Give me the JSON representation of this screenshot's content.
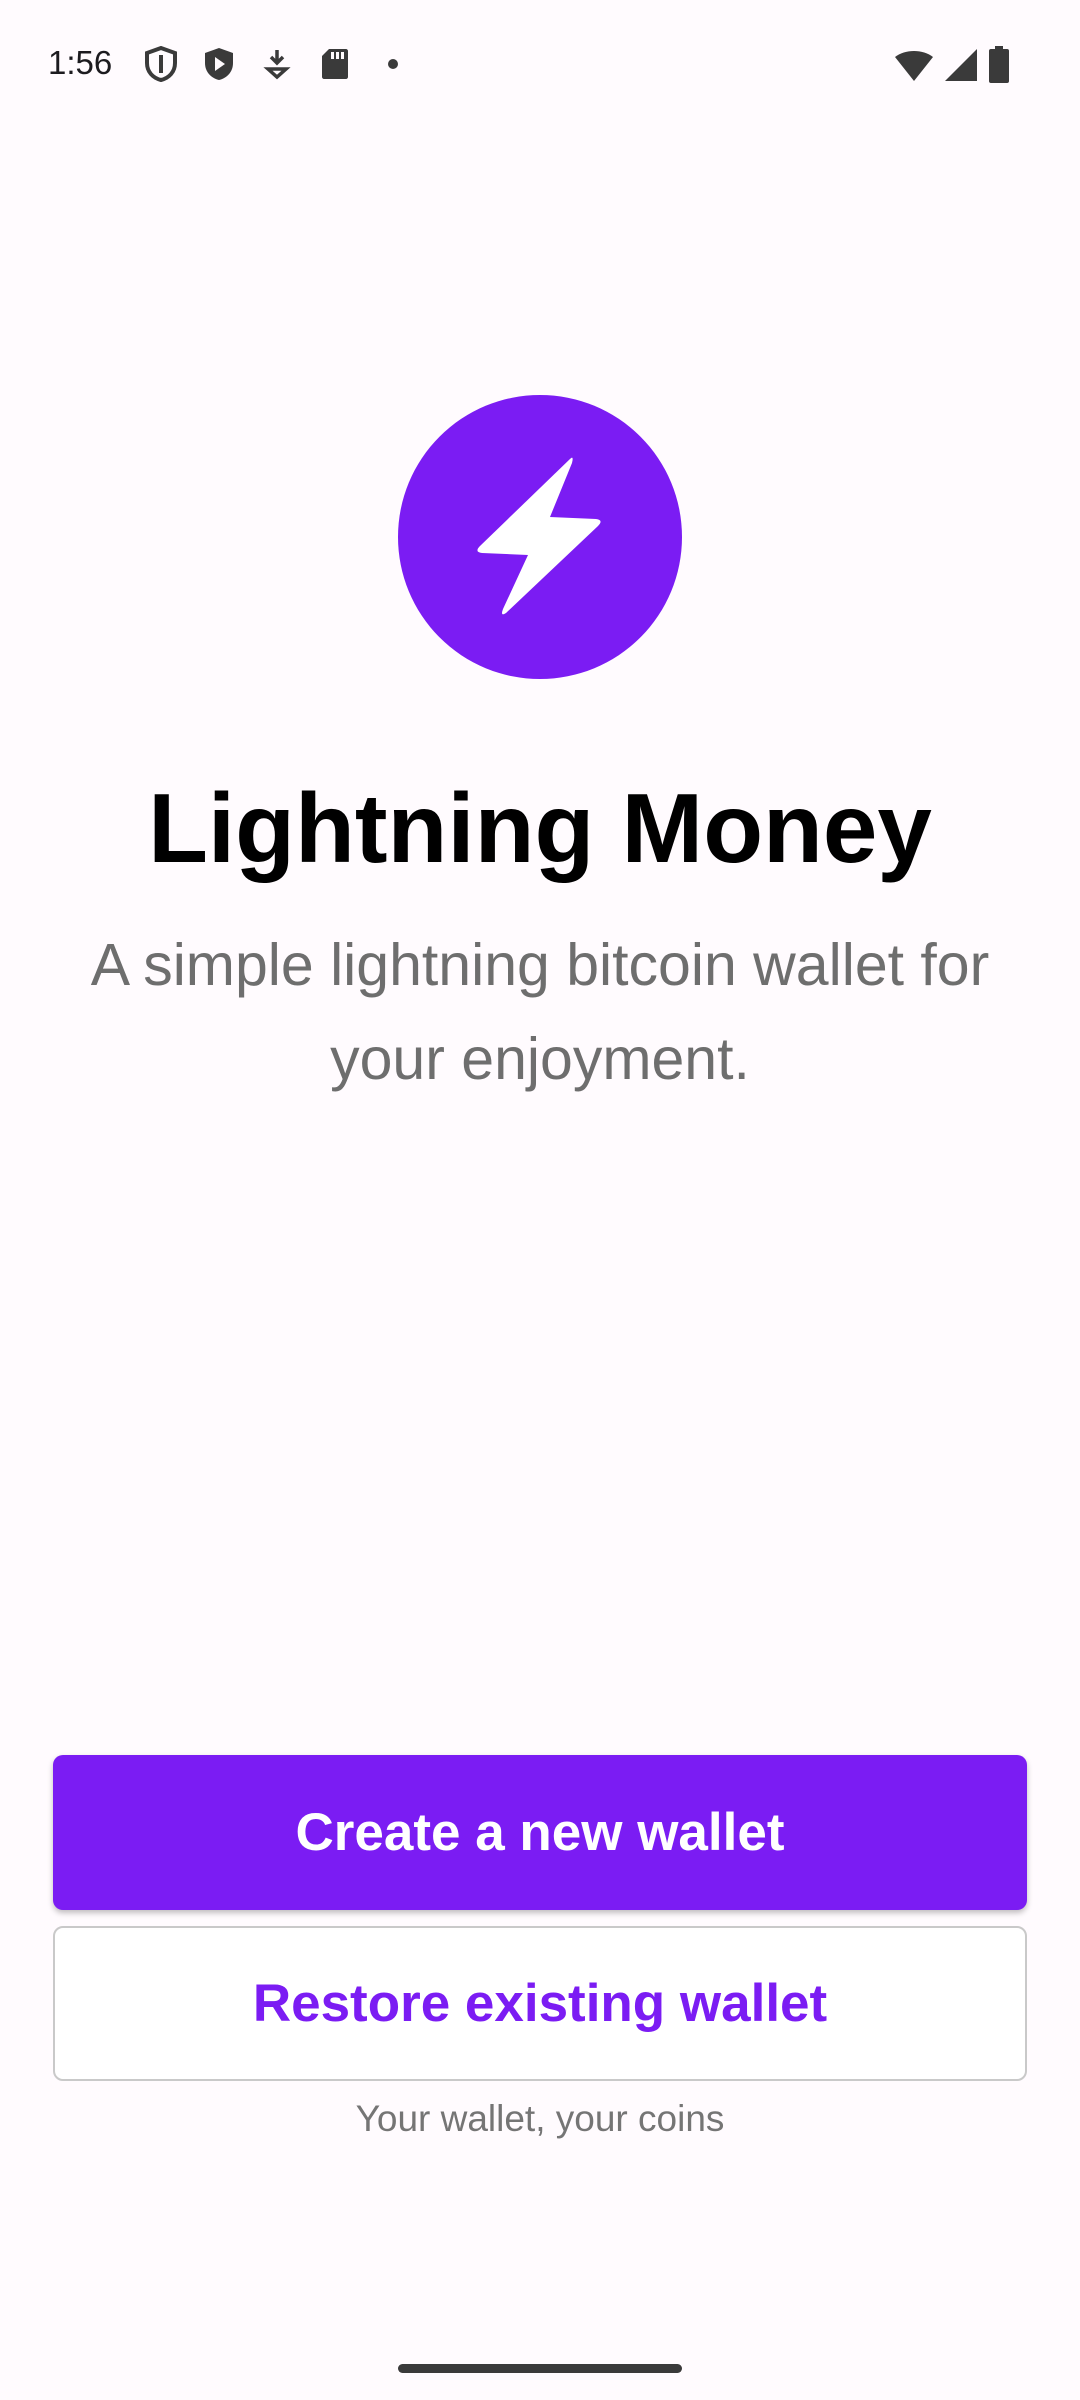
{
  "status_bar": {
    "time": "1:56",
    "left_icons": [
      "shield-outline-icon",
      "play-protect-icon",
      "download-icon",
      "sd-card-icon",
      "dot-icon"
    ],
    "right_icons": [
      "wifi-icon",
      "cell-signal-icon",
      "battery-icon"
    ]
  },
  "app": {
    "title": "Lightning Money",
    "subtitle": "A simple lightning bitcoin wallet for your enjoyment.",
    "logo_icon": "lightning-bolt-icon",
    "accent_color": "#7b1cf3"
  },
  "actions": {
    "create_label": "Create a new wallet",
    "restore_label": "Restore existing wallet"
  },
  "footer": {
    "tagline": "Your wallet, your coins"
  }
}
